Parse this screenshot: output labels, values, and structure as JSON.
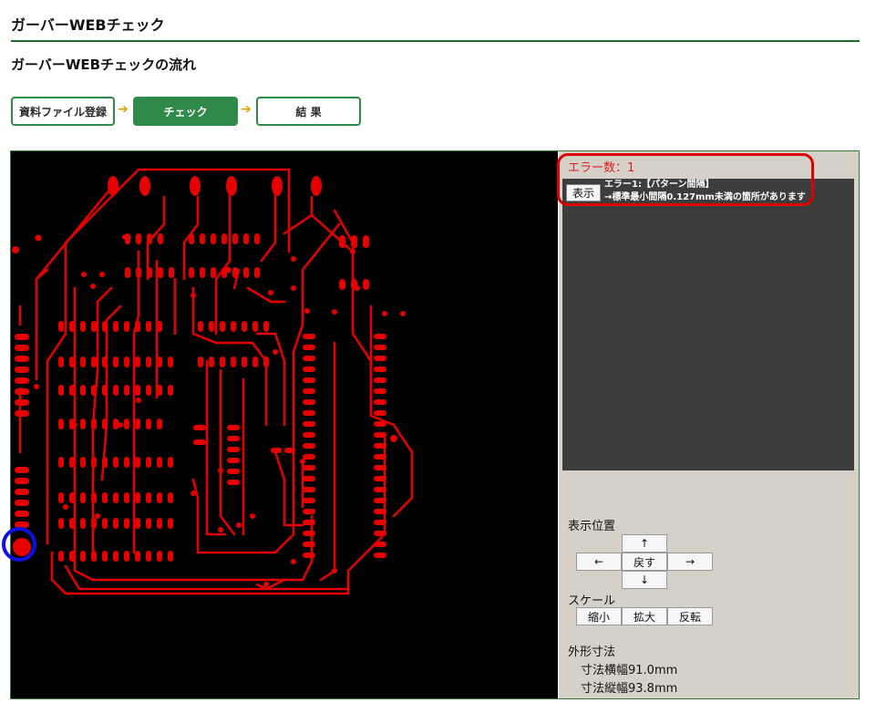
{
  "page": {
    "title": "ガーバーWEBチェック",
    "section_title": "ガーバーWEBチェックの流れ"
  },
  "steps": [
    {
      "label": "資料ファイル登録"
    },
    {
      "label": "チェック"
    },
    {
      "label": "結 果"
    }
  ],
  "step_arrow": "➔",
  "errors": {
    "count_label": "エラー数：1",
    "show_button": "表示",
    "item_title": "エラー1:【パターン間隔】",
    "item_message": "→標準最小間隔0.127mm未満の箇所があります"
  },
  "position": {
    "label": "表示位置",
    "up": "↑",
    "left": "←",
    "reset": "戻す",
    "right": "→",
    "down": "↓"
  },
  "scale": {
    "label": "スケール",
    "shrink": "縮小",
    "enlarge": "拡大",
    "flip": "反転"
  },
  "dimensions": {
    "label": "外形寸法",
    "width": "寸法横幅91.0mm",
    "height": "寸法縦幅93.8mm"
  },
  "colors": {
    "accent_green": "#2f8a4a",
    "trace_red": "#e60000",
    "error_red": "#e01b1b",
    "marker_blue": "#1010e6"
  }
}
